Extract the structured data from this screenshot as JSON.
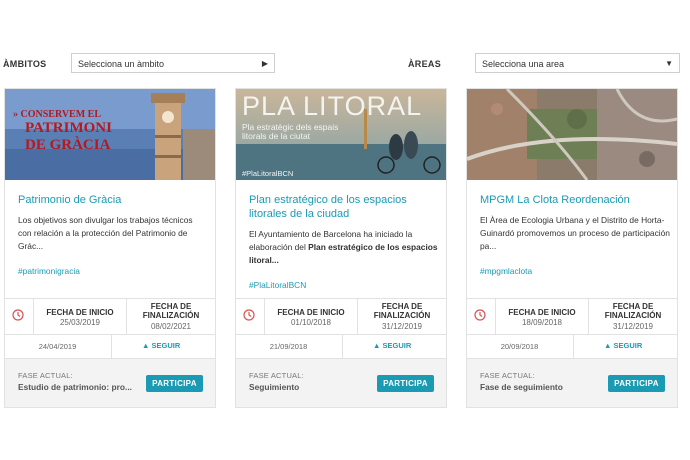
{
  "filters": {
    "ambitos_label": "ÀMBITOS",
    "ambitos_value": "Selecciona un àmbito",
    "areas_label": "ÀREAS",
    "areas_value": "Selecciona una area"
  },
  "colors": {
    "accent": "#1b9bb3",
    "clock": "#d9534f"
  },
  "cards": [
    {
      "banner_text_1": "» CONSERVEM EL",
      "banner_text_2": "PATRIMONI",
      "banner_text_3": "DE GRÀCIA",
      "title": "Patrimonio de Gràcia",
      "desc": "Los objetivos son divulgar los trabajos técnicos con relación a la protección del Patrimonio de Grác...",
      "tag": "#patrimonigracia",
      "start_label": "FECHA DE INICIO",
      "start_date": "25/03/2019",
      "end_label": "FECHA DE FINALIZACIÓN",
      "end_date": "08/02/2021",
      "published": "24/04/2019",
      "follow": "SEGUIR",
      "phase_label": "FASE ACTUAL:",
      "phase_value": "Estudio de patrimonio: pro...",
      "button": "PARTICIPA"
    },
    {
      "banner_text_1": "PLA LITORAL",
      "banner_text_2": "Pla estratègic dels espais litorals de la ciutat",
      "banner_text_3": "#PlaLitoralBCN",
      "title": "Plan estratégico de los espacios litorales de la ciudad",
      "desc_1": "El Ayuntamiento de Barcelona ha iniciado la elaboración del ",
      "desc_bold": "Plan estratégico de los espacios litoral...",
      "tag": "#PlaLitoralBCN",
      "start_label": "FECHA DE INICIO",
      "start_date": "01/10/2018",
      "end_label": "FECHA DE FINALIZACIÓN",
      "end_date": "31/12/2019",
      "published": "21/09/2018",
      "follow": "SEGUIR",
      "phase_label": "FASE ACTUAL:",
      "phase_value": "Seguimiento",
      "button": "PARTICIPA"
    },
    {
      "title": "MPGM La Clota Reordenación",
      "desc": "El Àrea de Ecologia Urbana y el Distrito de Horta-Guinardó promovemos un proceso de participación pa...",
      "tag": "#mpgmlaclota",
      "start_label": "FECHA DE INICIO",
      "start_date": "18/09/2018",
      "end_label": "FECHA DE FINALIZACIÓN",
      "end_date": "31/12/2019",
      "published": "20/09/2018",
      "follow": "SEGUIR",
      "phase_label": "FASE ACTUAL:",
      "phase_value": "Fase de seguimiento",
      "button": "PARTICIPA"
    }
  ]
}
